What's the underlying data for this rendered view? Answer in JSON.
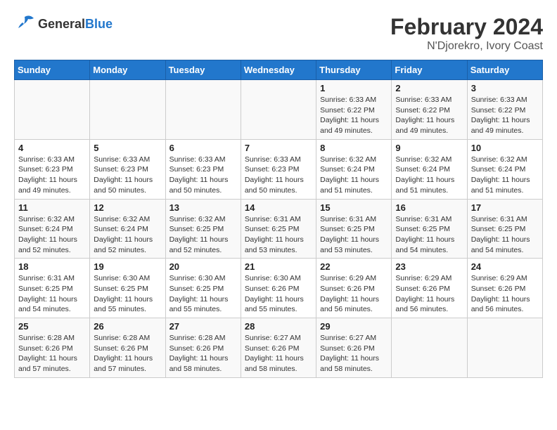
{
  "header": {
    "logo_general": "General",
    "logo_blue": "Blue",
    "main_title": "February 2024",
    "subtitle": "N'Djorekro, Ivory Coast"
  },
  "days_of_week": [
    "Sunday",
    "Monday",
    "Tuesday",
    "Wednesday",
    "Thursday",
    "Friday",
    "Saturday"
  ],
  "weeks": [
    [
      {
        "day": "",
        "empty": true
      },
      {
        "day": "",
        "empty": true
      },
      {
        "day": "",
        "empty": true
      },
      {
        "day": "",
        "empty": true
      },
      {
        "day": "1",
        "sunrise": "Sunrise: 6:33 AM",
        "sunset": "Sunset: 6:22 PM",
        "daylight": "Daylight: 11 hours and 49 minutes."
      },
      {
        "day": "2",
        "sunrise": "Sunrise: 6:33 AM",
        "sunset": "Sunset: 6:22 PM",
        "daylight": "Daylight: 11 hours and 49 minutes."
      },
      {
        "day": "3",
        "sunrise": "Sunrise: 6:33 AM",
        "sunset": "Sunset: 6:22 PM",
        "daylight": "Daylight: 11 hours and 49 minutes."
      }
    ],
    [
      {
        "day": "4",
        "sunrise": "Sunrise: 6:33 AM",
        "sunset": "Sunset: 6:23 PM",
        "daylight": "Daylight: 11 hours and 49 minutes."
      },
      {
        "day": "5",
        "sunrise": "Sunrise: 6:33 AM",
        "sunset": "Sunset: 6:23 PM",
        "daylight": "Daylight: 11 hours and 50 minutes."
      },
      {
        "day": "6",
        "sunrise": "Sunrise: 6:33 AM",
        "sunset": "Sunset: 6:23 PM",
        "daylight": "Daylight: 11 hours and 50 minutes."
      },
      {
        "day": "7",
        "sunrise": "Sunrise: 6:33 AM",
        "sunset": "Sunset: 6:23 PM",
        "daylight": "Daylight: 11 hours and 50 minutes."
      },
      {
        "day": "8",
        "sunrise": "Sunrise: 6:32 AM",
        "sunset": "Sunset: 6:24 PM",
        "daylight": "Daylight: 11 hours and 51 minutes."
      },
      {
        "day": "9",
        "sunrise": "Sunrise: 6:32 AM",
        "sunset": "Sunset: 6:24 PM",
        "daylight": "Daylight: 11 hours and 51 minutes."
      },
      {
        "day": "10",
        "sunrise": "Sunrise: 6:32 AM",
        "sunset": "Sunset: 6:24 PM",
        "daylight": "Daylight: 11 hours and 51 minutes."
      }
    ],
    [
      {
        "day": "11",
        "sunrise": "Sunrise: 6:32 AM",
        "sunset": "Sunset: 6:24 PM",
        "daylight": "Daylight: 11 hours and 52 minutes."
      },
      {
        "day": "12",
        "sunrise": "Sunrise: 6:32 AM",
        "sunset": "Sunset: 6:24 PM",
        "daylight": "Daylight: 11 hours and 52 minutes."
      },
      {
        "day": "13",
        "sunrise": "Sunrise: 6:32 AM",
        "sunset": "Sunset: 6:25 PM",
        "daylight": "Daylight: 11 hours and 52 minutes."
      },
      {
        "day": "14",
        "sunrise": "Sunrise: 6:31 AM",
        "sunset": "Sunset: 6:25 PM",
        "daylight": "Daylight: 11 hours and 53 minutes."
      },
      {
        "day": "15",
        "sunrise": "Sunrise: 6:31 AM",
        "sunset": "Sunset: 6:25 PM",
        "daylight": "Daylight: 11 hours and 53 minutes."
      },
      {
        "day": "16",
        "sunrise": "Sunrise: 6:31 AM",
        "sunset": "Sunset: 6:25 PM",
        "daylight": "Daylight: 11 hours and 54 minutes."
      },
      {
        "day": "17",
        "sunrise": "Sunrise: 6:31 AM",
        "sunset": "Sunset: 6:25 PM",
        "daylight": "Daylight: 11 hours and 54 minutes."
      }
    ],
    [
      {
        "day": "18",
        "sunrise": "Sunrise: 6:31 AM",
        "sunset": "Sunset: 6:25 PM",
        "daylight": "Daylight: 11 hours and 54 minutes."
      },
      {
        "day": "19",
        "sunrise": "Sunrise: 6:30 AM",
        "sunset": "Sunset: 6:25 PM",
        "daylight": "Daylight: 11 hours and 55 minutes."
      },
      {
        "day": "20",
        "sunrise": "Sunrise: 6:30 AM",
        "sunset": "Sunset: 6:25 PM",
        "daylight": "Daylight: 11 hours and 55 minutes."
      },
      {
        "day": "21",
        "sunrise": "Sunrise: 6:30 AM",
        "sunset": "Sunset: 6:26 PM",
        "daylight": "Daylight: 11 hours and 55 minutes."
      },
      {
        "day": "22",
        "sunrise": "Sunrise: 6:29 AM",
        "sunset": "Sunset: 6:26 PM",
        "daylight": "Daylight: 11 hours and 56 minutes."
      },
      {
        "day": "23",
        "sunrise": "Sunrise: 6:29 AM",
        "sunset": "Sunset: 6:26 PM",
        "daylight": "Daylight: 11 hours and 56 minutes."
      },
      {
        "day": "24",
        "sunrise": "Sunrise: 6:29 AM",
        "sunset": "Sunset: 6:26 PM",
        "daylight": "Daylight: 11 hours and 56 minutes."
      }
    ],
    [
      {
        "day": "25",
        "sunrise": "Sunrise: 6:28 AM",
        "sunset": "Sunset: 6:26 PM",
        "daylight": "Daylight: 11 hours and 57 minutes."
      },
      {
        "day": "26",
        "sunrise": "Sunrise: 6:28 AM",
        "sunset": "Sunset: 6:26 PM",
        "daylight": "Daylight: 11 hours and 57 minutes."
      },
      {
        "day": "27",
        "sunrise": "Sunrise: 6:28 AM",
        "sunset": "Sunset: 6:26 PM",
        "daylight": "Daylight: 11 hours and 58 minutes."
      },
      {
        "day": "28",
        "sunrise": "Sunrise: 6:27 AM",
        "sunset": "Sunset: 6:26 PM",
        "daylight": "Daylight: 11 hours and 58 minutes."
      },
      {
        "day": "29",
        "sunrise": "Sunrise: 6:27 AM",
        "sunset": "Sunset: 6:26 PM",
        "daylight": "Daylight: 11 hours and 58 minutes."
      },
      {
        "day": "",
        "empty": true
      },
      {
        "day": "",
        "empty": true
      }
    ]
  ]
}
